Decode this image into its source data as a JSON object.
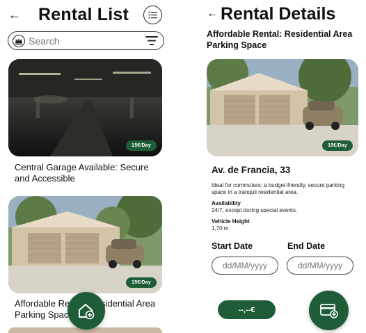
{
  "list_screen": {
    "title": "Rental List",
    "back_icon": "arrow-left-icon",
    "list_view_icon": "list-icon",
    "search": {
      "placeholder": "Search",
      "logo_icon": "crown-logo-icon",
      "filter_icon": "filter-lines-icon"
    },
    "cards": [
      {
        "title": "Central Garage Available: Secure and Accessible",
        "price": "15€/Day",
        "image": "underground-parking-photo"
      },
      {
        "title": "Affordable Rental: Residential Area Parking Space",
        "price": "15€/Day",
        "image": "garage-with-car-photo"
      }
    ],
    "fab_icon": "add-home-icon"
  },
  "details_screen": {
    "title": "Rental Details",
    "back_icon": "arrow-left-icon",
    "subtitle": "Affordable Rental: Residential Area Parking Space",
    "price": "15€/Day",
    "image": "garage-with-car-photo",
    "address": "Av. de Francia, 33",
    "description": "Ideal for commuters: a budget-friendly, secure parking space in a tranquil residential area.",
    "availability_label": "Availability",
    "availability_value": "24/7, except during special events.",
    "vehicle_height_label": "Vehicle Height",
    "vehicle_height_value": "1,70 m",
    "start_date_label": "Start Date",
    "end_date_label": "End Date",
    "date_placeholder": "dd/MM/yyyy",
    "total_price": "--,--€",
    "fab_icon": "add-card-icon"
  },
  "colors": {
    "brand_green": "#1f5d38",
    "text": "#111111",
    "background": "#ffffff"
  }
}
